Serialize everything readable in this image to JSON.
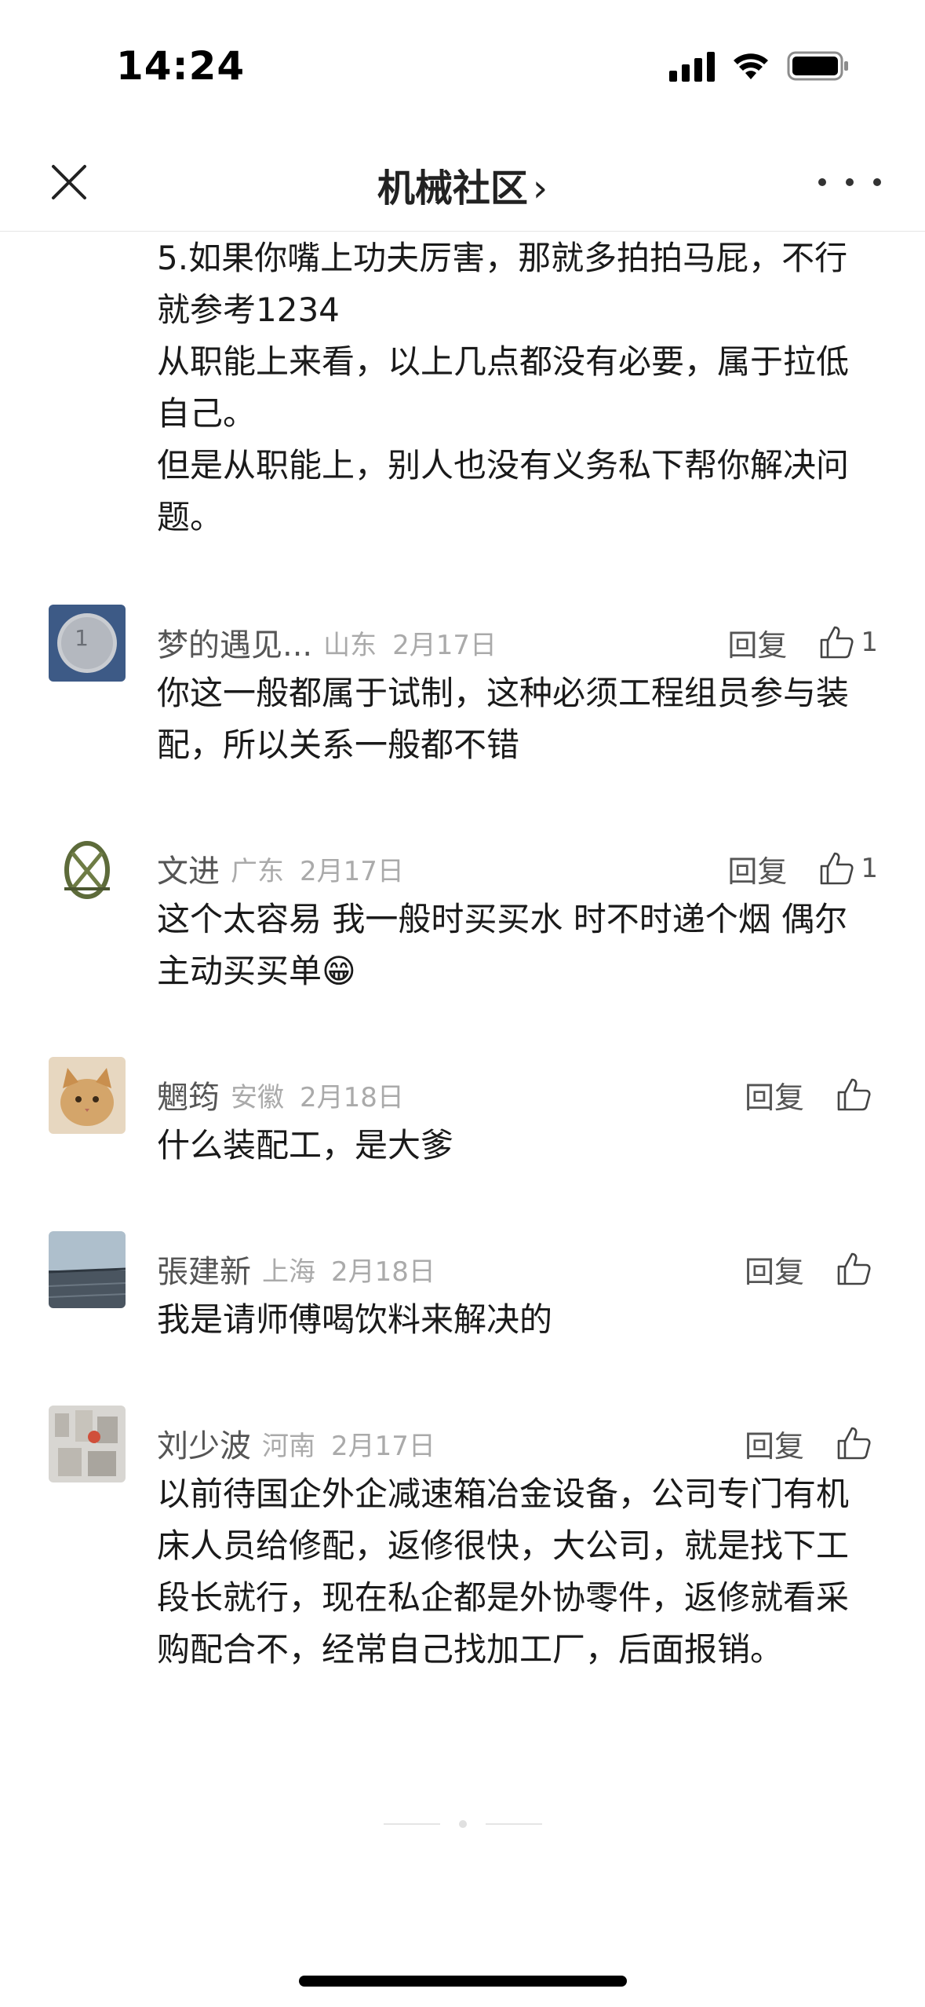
{
  "status_bar": {
    "time": "14:24",
    "icons": [
      "cellular-signal-icon",
      "wifi-icon",
      "battery-icon"
    ]
  },
  "nav": {
    "title": "机械社区",
    "title_chevron": "›",
    "left_icon": "close-icon",
    "right_icon": "more-icon"
  },
  "previous_reply": {
    "paragraphs": [
      "5.如果你嘴上功夫厉害，那就多拍拍马屁，不行就参考1234",
      "从职能上来看，以上几点都没有必要，属于拉低自己。",
      "但是从职能上，别人也没有义务私下帮你解决问题。"
    ]
  },
  "comments": [
    {
      "name": "梦的遇见...",
      "location": "山东",
      "date": "2月17日",
      "reply_label": "回复",
      "like_count": "1",
      "text": "你这一般都属于试制，这种必须工程组员参与装配，所以关系一般都不错"
    },
    {
      "name": "文进",
      "location": "广东",
      "date": "2月17日",
      "reply_label": "回复",
      "like_count": "1",
      "text": "这个太容易 我一般时买买水 时不时递个烟 偶尔主动买买单😁"
    },
    {
      "name": "魍筠",
      "location": "安徽",
      "date": "2月18日",
      "reply_label": "回复",
      "like_count": "",
      "text": "什么装配工，是大爹"
    },
    {
      "name": "張建新",
      "location": "上海",
      "date": "2月18日",
      "reply_label": "回复",
      "like_count": "",
      "text": "我是请师傅喝饮料来解决的"
    },
    {
      "name": "刘少波",
      "location": "河南",
      "date": "2月17日",
      "reply_label": "回复",
      "like_count": "",
      "text": "以前待国企外企减速箱冶金设备，公司专门有机床人员给修配，返修很快，大公司，就是找下工段长就行，现在私企都是外协零件，返修就看采购配合不，经常自己找加工厂，后面报销。"
    }
  ],
  "colors": {
    "text_primary": "#1a1a1a",
    "text_secondary": "#555555",
    "text_muted": "#aaaaaa",
    "divider": "#e6e6e6"
  }
}
